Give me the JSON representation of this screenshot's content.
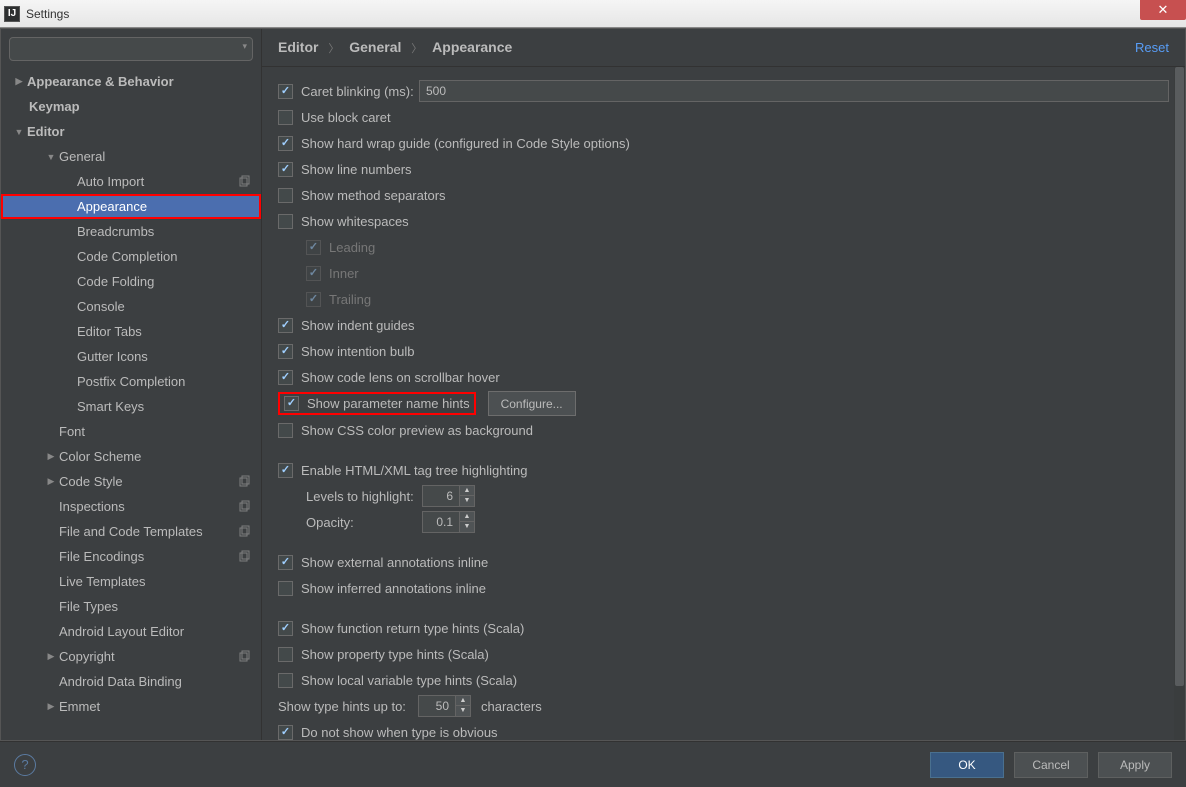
{
  "window": {
    "title": "Settings"
  },
  "sidebar": {
    "search_placeholder": "",
    "items": {
      "appearance_behavior": "Appearance & Behavior",
      "keymap": "Keymap",
      "editor": "Editor",
      "general": "General",
      "auto_import": "Auto Import",
      "appearance": "Appearance",
      "breadcrumbs": "Breadcrumbs",
      "code_completion": "Code Completion",
      "code_folding": "Code Folding",
      "console": "Console",
      "editor_tabs": "Editor Tabs",
      "gutter_icons": "Gutter Icons",
      "postfix_completion": "Postfix Completion",
      "smart_keys": "Smart Keys",
      "font": "Font",
      "color_scheme": "Color Scheme",
      "code_style": "Code Style",
      "inspections": "Inspections",
      "file_code_templates": "File and Code Templates",
      "file_encodings": "File Encodings",
      "live_templates": "Live Templates",
      "file_types": "File Types",
      "android_layout_editor": "Android Layout Editor",
      "copyright": "Copyright",
      "android_data_binding": "Android Data Binding",
      "emmet": "Emmet"
    }
  },
  "breadcrumb": {
    "p0": "Editor",
    "p1": "General",
    "p2": "Appearance"
  },
  "reset": "Reset",
  "opts": {
    "caret_blinking": "Caret blinking (ms):",
    "caret_blinking_value": "500",
    "use_block_caret": "Use block caret",
    "show_hard_wrap": "Show hard wrap guide (configured in Code Style options)",
    "show_line_numbers": "Show line numbers",
    "show_method_sep": "Show method separators",
    "show_whitespaces": "Show whitespaces",
    "ws_leading": "Leading",
    "ws_inner": "Inner",
    "ws_trailing": "Trailing",
    "show_indent_guides": "Show indent guides",
    "show_intention_bulb": "Show intention bulb",
    "show_code_lens": "Show code lens on scrollbar hover",
    "show_param_hints": "Show parameter name hints",
    "configure": "Configure...",
    "show_css_color": "Show CSS color preview as background",
    "enable_tag_tree": "Enable HTML/XML tag tree highlighting",
    "levels_to_highlight": "Levels to highlight:",
    "levels_value": "6",
    "opacity": "Opacity:",
    "opacity_value": "0.1",
    "show_ext_ann": "Show external annotations inline",
    "show_inf_ann": "Show inferred annotations inline",
    "show_fn_return": "Show function return type hints (Scala)",
    "show_prop_hints": "Show property type hints (Scala)",
    "show_local_var": "Show local variable type hints (Scala)",
    "show_type_hints_up_to": "Show type hints up to:",
    "type_hints_value": "50",
    "characters": "characters",
    "do_not_show_obvious": "Do not show when type is obvious"
  },
  "footer": {
    "ok": "OK",
    "cancel": "Cancel",
    "apply": "Apply"
  }
}
